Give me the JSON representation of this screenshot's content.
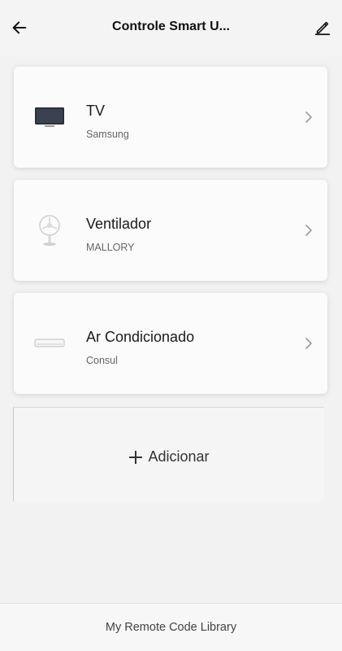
{
  "header": {
    "title": "Controle Smart U...",
    "back_icon": "arrow-left-icon",
    "edit_icon": "pencil-icon"
  },
  "devices": [
    {
      "name": "TV",
      "brand": "Samsung",
      "icon": "tv-icon"
    },
    {
      "name": "Ventilador",
      "brand": "MALLORY",
      "icon": "fan-icon"
    },
    {
      "name": "Ar Condicionado",
      "brand": "Consul",
      "icon": "air-conditioner-icon"
    }
  ],
  "add": {
    "label": "Adicionar",
    "icon": "plus-icon"
  },
  "footer": {
    "label": "My Remote Code Library"
  }
}
